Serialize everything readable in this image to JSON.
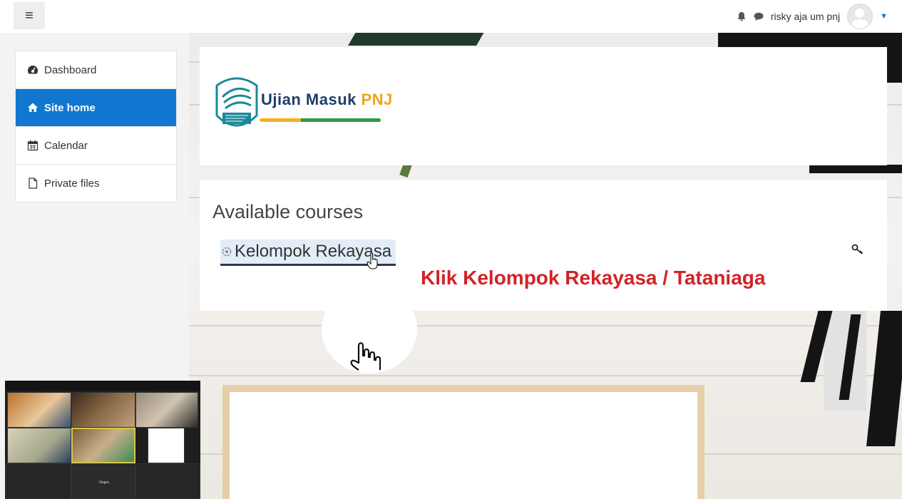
{
  "navbar": {
    "menu_icon": "hamburger-icon",
    "notifications_icon": "bell-icon",
    "messages_icon": "chat-icon",
    "user_name": "risky aja um pnj",
    "user_menu_icon": "caret-down-icon"
  },
  "sidebar": {
    "items": [
      {
        "label": "Dashboard",
        "icon": "dashboard-icon",
        "active": false
      },
      {
        "label": "Site home",
        "icon": "home-icon",
        "active": true
      },
      {
        "label": "Calendar",
        "icon": "calendar-icon",
        "active": false
      },
      {
        "label": "Private files",
        "icon": "file-icon",
        "active": false
      }
    ]
  },
  "header": {
    "logo_text": "Ujian Masuk",
    "logo_accent": "PNJ"
  },
  "courses": {
    "heading": "Available courses",
    "items": [
      {
        "name": "Kelompok Rekayasa"
      }
    ]
  },
  "annotation": {
    "instruction": "Klik Kelompok Rekayasa / Tataniaga"
  },
  "video_call": {
    "participant_label": "Nugra"
  },
  "colors": {
    "accent": "#1177d1",
    "instruction": "#d32227",
    "logo_text": "#1e3d6b",
    "logo_accent": "#f0a41b"
  }
}
